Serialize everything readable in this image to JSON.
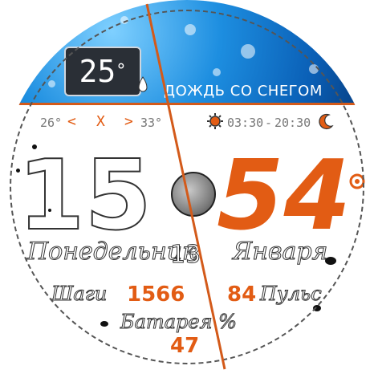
{
  "weather": {
    "temperature": "25",
    "degree": "°",
    "condition": "ДОЖДЬ СО СНЕГОМ"
  },
  "forecast": {
    "low": "26°",
    "left_arrow": "<",
    "separator": "X",
    "right_arrow": ">",
    "high": "33°",
    "sunrise": "03:30",
    "sunset": "20:30"
  },
  "time": {
    "hours": "15",
    "minutes": "54"
  },
  "date": {
    "weekday": "Понедельник",
    "day": "13",
    "month": "Января"
  },
  "stats": {
    "steps_label": "Шаги",
    "steps": "1566",
    "pulse": "84",
    "pulse_label": "Пульс",
    "battery_label": "Батарея %",
    "battery": "47"
  },
  "colors": {
    "accent": "#e25c14",
    "sky": "#1d8ee0"
  }
}
